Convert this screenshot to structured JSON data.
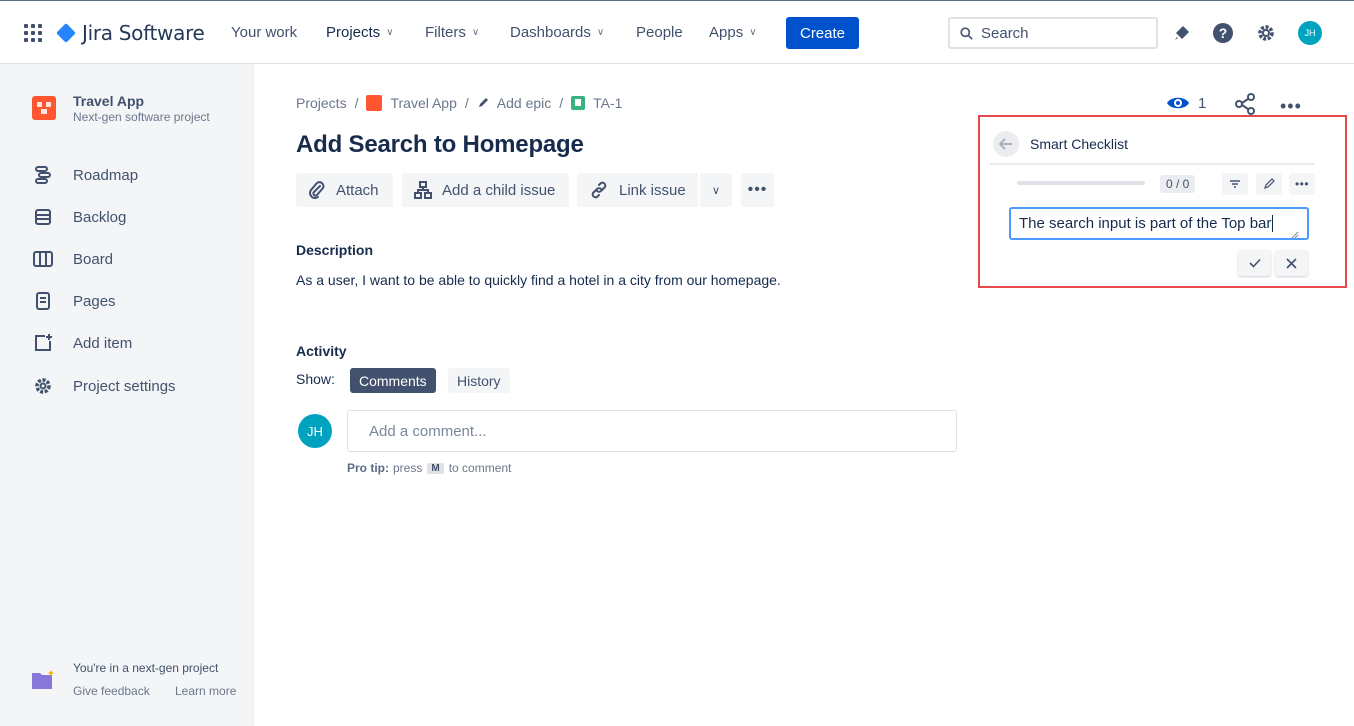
{
  "topnav": {
    "logo_text": "Jira Software",
    "items": [
      {
        "label": "Your work",
        "chevron": false
      },
      {
        "label": "Projects",
        "chevron": true
      },
      {
        "label": "Filters",
        "chevron": true
      },
      {
        "label": "Dashboards",
        "chevron": true
      },
      {
        "label": "People",
        "chevron": false
      },
      {
        "label": "Apps",
        "chevron": true
      }
    ],
    "create_label": "Create",
    "search_placeholder": "Search",
    "avatar_initials": "JH"
  },
  "sidebar": {
    "project_name": "Travel App",
    "project_type": "Next-gen software project",
    "items": [
      {
        "label": "Roadmap",
        "icon": "roadmap-icon"
      },
      {
        "label": "Backlog",
        "icon": "backlog-icon"
      },
      {
        "label": "Board",
        "icon": "board-icon"
      },
      {
        "label": "Pages",
        "icon": "pages-icon"
      },
      {
        "label": "Add item",
        "icon": "add-item-icon"
      },
      {
        "label": "Project settings",
        "icon": "gear-icon"
      }
    ],
    "footer_title": "You're in a next-gen project",
    "footer_feedback": "Give feedback",
    "footer_learn": "Learn more"
  },
  "breadcrumb": {
    "projects": "Projects",
    "project": "Travel App",
    "epic": "Add epic",
    "issue_key": "TA-1"
  },
  "issue": {
    "title": "Add Search to Homepage",
    "toolbar": {
      "attach": "Attach",
      "child_issue": "Add a child issue",
      "link_issue": "Link issue"
    },
    "description_label": "Description",
    "description": "As a user, I want to be able to quickly find a hotel in a city from our homepage.",
    "activity_label": "Activity",
    "show_label": "Show:",
    "show_comments": "Comments",
    "show_history": "History",
    "comment_avatar": "JH",
    "comment_placeholder": "Add a comment...",
    "protip_bold": "Pro tip:",
    "protip_press": "press",
    "protip_key": "M",
    "protip_rest": "to comment",
    "watch_count": "1"
  },
  "checklist": {
    "title": "Smart Checklist",
    "count": "0 / 0",
    "progress": 0,
    "input_value": "The search input is part of the Top bar"
  },
  "colors": {
    "brand_blue": "#0052cc",
    "highlight_border": "#e5484d",
    "avatar_teal": "#00a3bf",
    "project_red": "#ff5630"
  }
}
